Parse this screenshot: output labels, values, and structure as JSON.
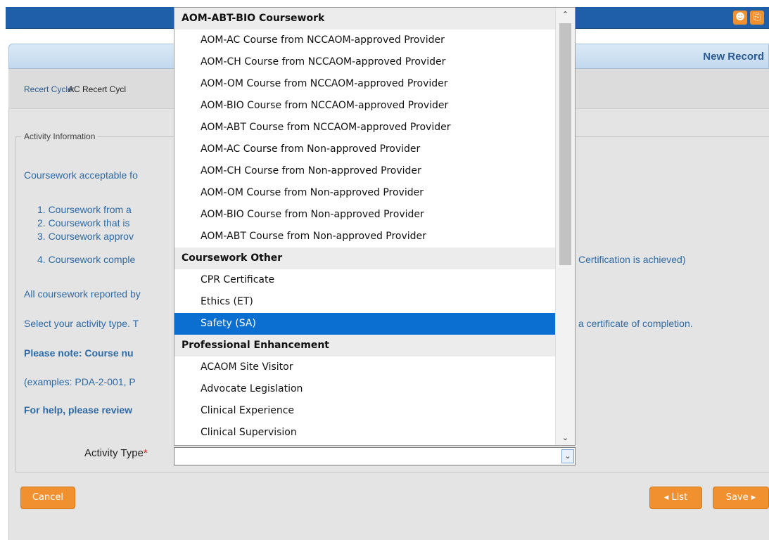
{
  "topbar": {
    "user_icon": "user-icon",
    "logout_icon": "logout-icon"
  },
  "panel": {
    "title": "New Record"
  },
  "recert": {
    "label": "Recert Cycle:",
    "value": "AC Recert Cycl"
  },
  "fieldset": {
    "legend": "Activity Information"
  },
  "intro": {
    "line1": "Coursework acceptable fo",
    "items": [
      "1. Coursework from a",
      "2. Coursework that is",
      "3. Coursework approv",
      "4. Coursework comple"
    ],
    "item4_tail": "Certification is achieved)",
    "line2": "All coursework reported by",
    "line3": "Select your activity type. T",
    "line3_tail": "a certificate of completion.",
    "note": "Please note: Course nu",
    "examples": "(examples: PDA-2-001, P",
    "help": "For help, please review"
  },
  "activity_type": {
    "label": "Activity Type",
    "required_mark": "*",
    "value": ""
  },
  "dropdown": {
    "rows": [
      {
        "label": "AOM-ABT-BIO Coursework",
        "kind": "group"
      },
      {
        "label": "AOM-AC Course from NCCAOM-approved Provider",
        "kind": "option"
      },
      {
        "label": "AOM-CH Course from NCCAOM-approved Provider",
        "kind": "option"
      },
      {
        "label": "AOM-OM Course from NCCAOM-approved Provider",
        "kind": "option"
      },
      {
        "label": "AOM-BIO Course from NCCAOM-approved Provider",
        "kind": "option"
      },
      {
        "label": "AOM-ABT Course from NCCAOM-approved Provider",
        "kind": "option"
      },
      {
        "label": "AOM-AC Course from Non-approved Provider",
        "kind": "option"
      },
      {
        "label": "AOM-CH Course from Non-approved Provider",
        "kind": "option"
      },
      {
        "label": "AOM-OM Course from Non-approved Provider",
        "kind": "option"
      },
      {
        "label": "AOM-BIO Course from Non-approved Provider",
        "kind": "option"
      },
      {
        "label": "AOM-ABT Course from Non-approved Provider",
        "kind": "option"
      },
      {
        "label": "Coursework Other",
        "kind": "group"
      },
      {
        "label": "CPR Certificate",
        "kind": "option"
      },
      {
        "label": "Ethics (ET)",
        "kind": "option"
      },
      {
        "label": "Safety (SA)",
        "kind": "selected"
      },
      {
        "label": "Professional Enhancement",
        "kind": "group"
      },
      {
        "label": "ACAOM Site Visitor",
        "kind": "option"
      },
      {
        "label": "Advocate Legislation",
        "kind": "option"
      },
      {
        "label": "Clinical Experience",
        "kind": "option"
      },
      {
        "label": "Clinical Supervision",
        "kind": "option"
      }
    ]
  },
  "buttons": {
    "cancel": "Cancel",
    "list": "◂ List",
    "save": "Save ▸"
  },
  "colors": {
    "topbar": "#1f5fa9",
    "accent_orange": "#f0902e",
    "link_blue": "#2d6aa6",
    "selected_blue": "#0a6fd1"
  }
}
